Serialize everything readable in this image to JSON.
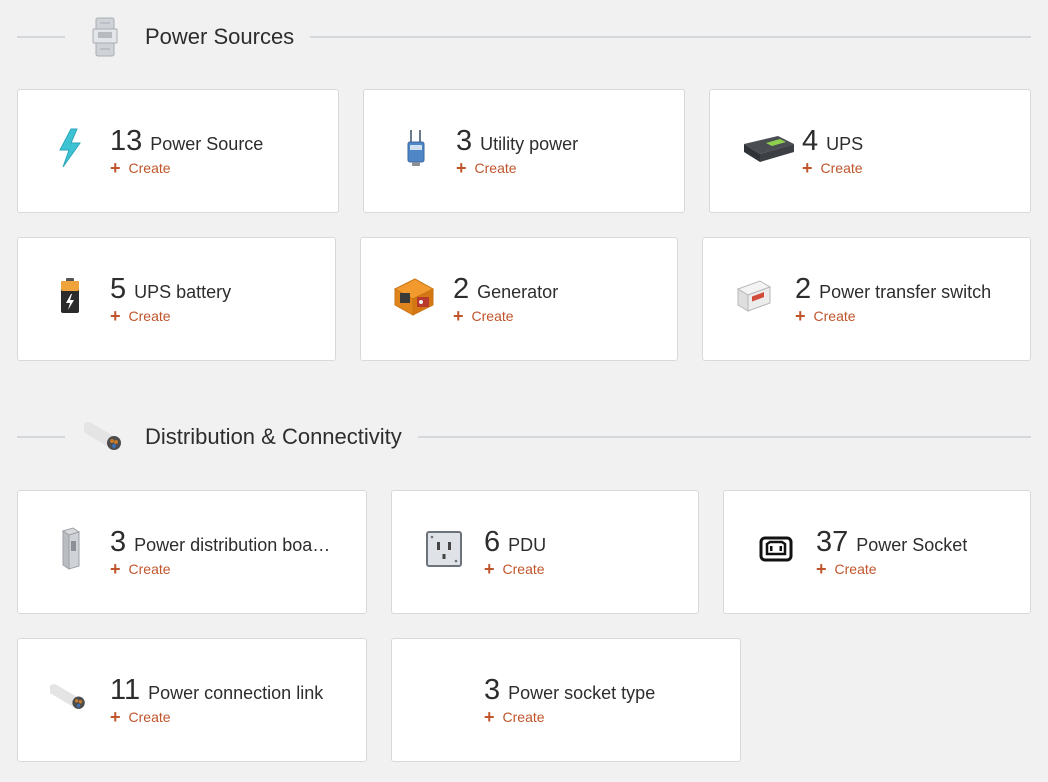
{
  "sections": [
    {
      "title": "Power Sources",
      "cards": [
        {
          "count": "13",
          "name": "Power Source",
          "create": "Create",
          "icon": "lightning-icon"
        },
        {
          "count": "3",
          "name": "Utility power",
          "create": "Create",
          "icon": "utility-pole-icon"
        },
        {
          "count": "4",
          "name": "UPS",
          "create": "Create",
          "icon": "ups-icon"
        },
        {
          "count": "5",
          "name": "UPS battery",
          "create": "Create",
          "icon": "battery-icon"
        },
        {
          "count": "2",
          "name": "Generator",
          "create": "Create",
          "icon": "generator-icon"
        },
        {
          "count": "2",
          "name": "Power transfer switch",
          "create": "Create",
          "icon": "transfer-switch-icon"
        }
      ]
    },
    {
      "title": "Distribution & Connectivity",
      "cards": [
        {
          "count": "3",
          "name": "Power distribution boa…",
          "create": "Create",
          "icon": "distribution-board-icon"
        },
        {
          "count": "6",
          "name": "PDU",
          "create": "Create",
          "icon": "pdu-outlet-icon"
        },
        {
          "count": "37",
          "name": "Power Socket",
          "create": "Create",
          "icon": "power-socket-icon"
        },
        {
          "count": "11",
          "name": "Power connection link",
          "create": "Create",
          "icon": "cable-icon"
        },
        {
          "count": "3",
          "name": "Power socket type",
          "create": "Create",
          "icon": ""
        }
      ]
    }
  ],
  "colors": {
    "accent": "#c0552b",
    "background": "#f1f1f1",
    "card": "#ffffff",
    "divider": "#d4d7dc"
  }
}
